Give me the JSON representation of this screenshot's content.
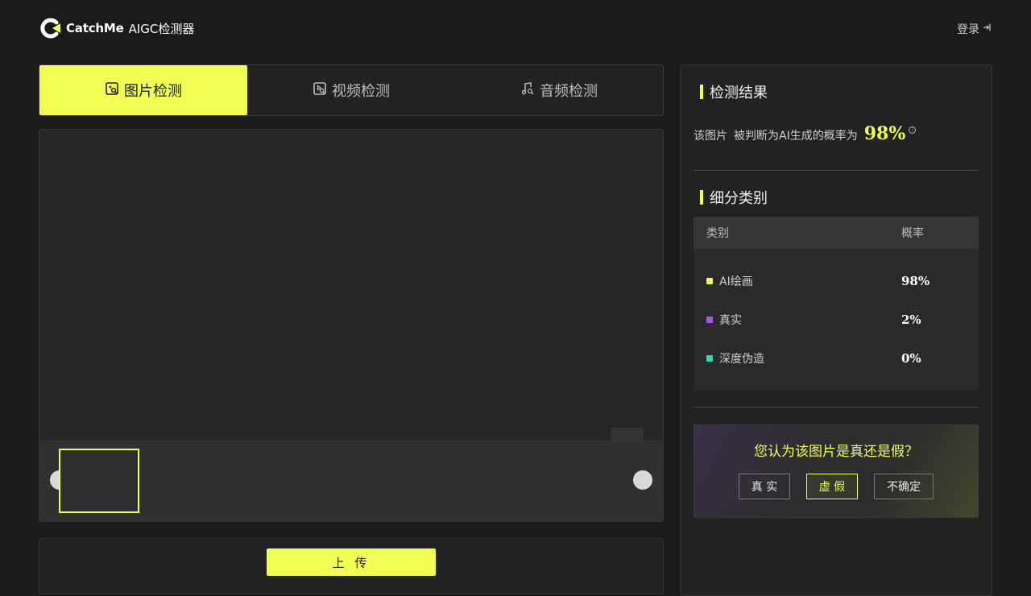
{
  "header": {
    "brand": "CatchMe",
    "product": "AIGC检测器",
    "login_label": "登录"
  },
  "tabs": [
    {
      "label": "图片检测",
      "icon": "image-search-icon",
      "active": true
    },
    {
      "label": "视频检测",
      "icon": "video-search-icon",
      "active": false
    },
    {
      "label": "音频检测",
      "icon": "music-search-icon",
      "active": false
    }
  ],
  "upload": {
    "button_label": "上 传"
  },
  "result": {
    "title": "检测结果",
    "subject": "该图片",
    "statement": "被判断为AI生成的概率为",
    "probability": "98%",
    "info_icon": "i",
    "breakdown_title": "细分类别",
    "table": {
      "headers": [
        "类别",
        "概率"
      ],
      "rows": [
        {
          "label": "AI绘画",
          "value": "98%",
          "color": "#f0ff52"
        },
        {
          "label": "真实",
          "value": "2%",
          "color": "#a855f7"
        },
        {
          "label": "深度伪造",
          "value": "0%",
          "color": "#2dd4bf"
        }
      ]
    },
    "vote": {
      "question": "您认为该图片是真还是假？",
      "options": [
        "真 实",
        "虚 假",
        "不确定"
      ],
      "selected_index": 1
    }
  },
  "colors": {
    "accent": "#f0ff52",
    "background": "#1a1a1a"
  }
}
